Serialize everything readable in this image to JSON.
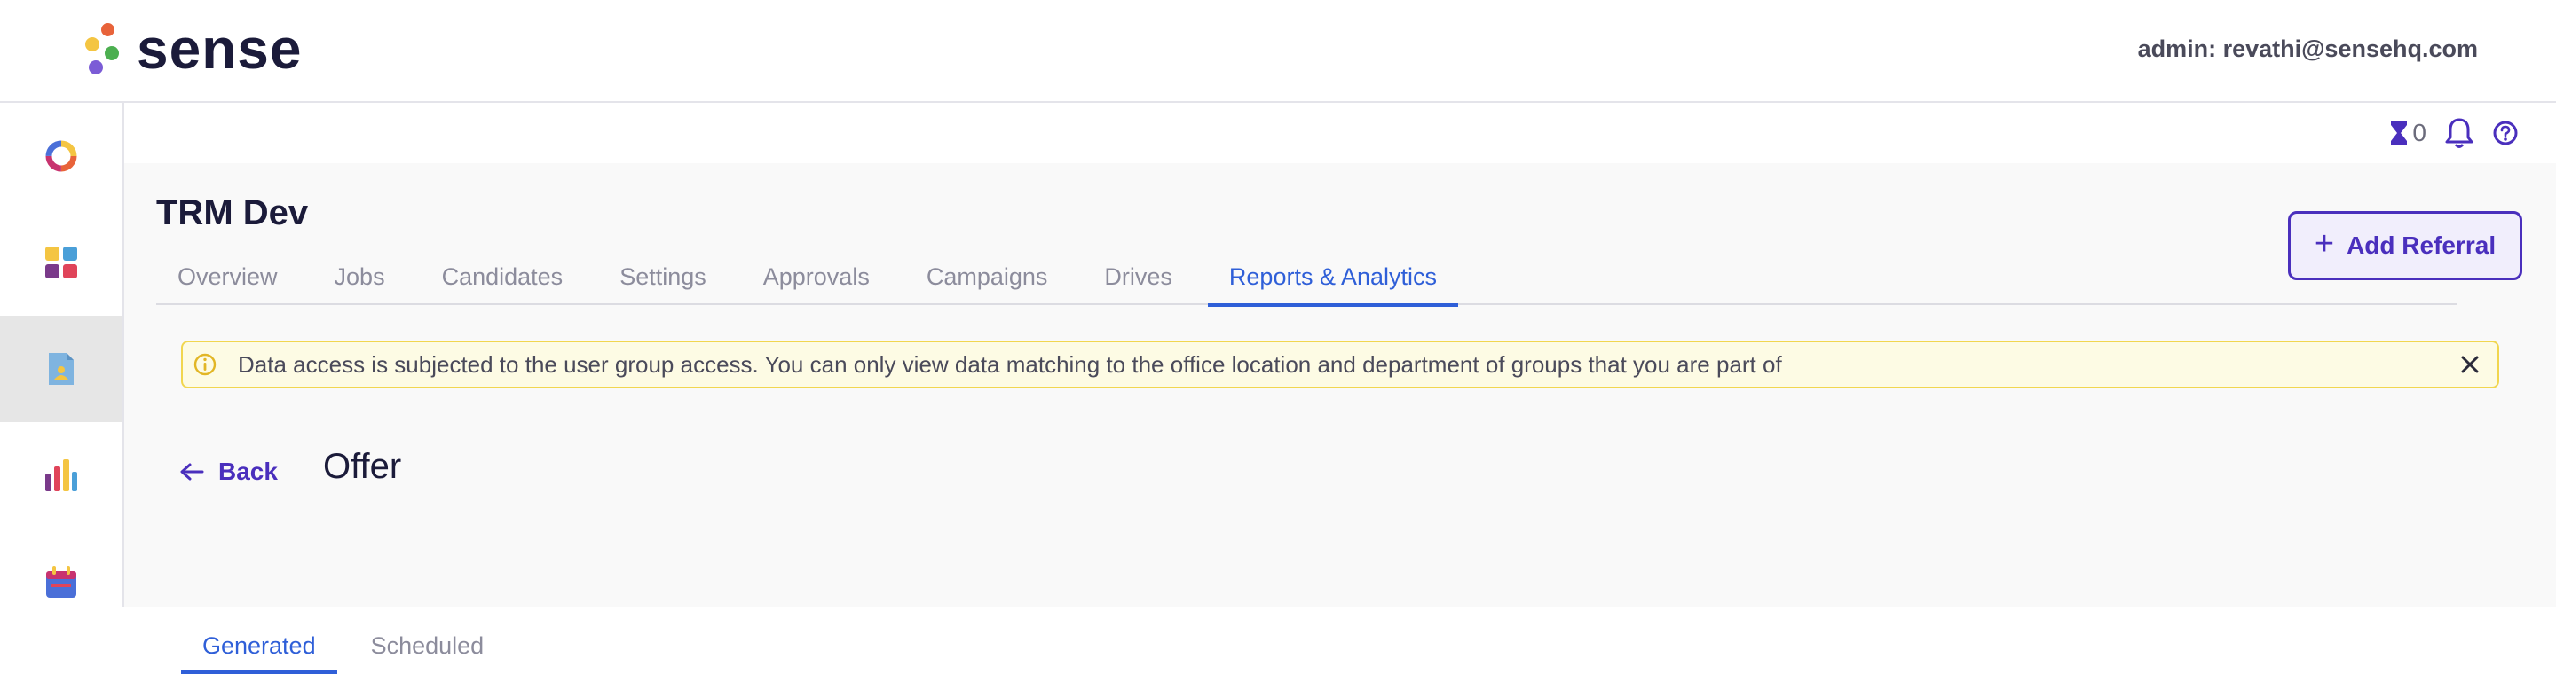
{
  "header": {
    "brand": "sense",
    "admin_label": "admin: revathi@sensehq.com"
  },
  "sidebar": {
    "items": [
      {
        "name": "dashboard-icon",
        "active": false
      },
      {
        "name": "apps-grid-icon",
        "active": false
      },
      {
        "name": "document-user-icon",
        "active": true
      },
      {
        "name": "bar-chart-icon",
        "active": false
      },
      {
        "name": "calendar-icon",
        "active": false
      }
    ]
  },
  "utility": {
    "hourglass_count": "0",
    "icons": [
      "hourglass-icon",
      "bell-icon",
      "help-icon"
    ]
  },
  "page": {
    "title": "TRM Dev",
    "add_button_label": "Add Referral"
  },
  "tabs": [
    {
      "label": "Overview",
      "active": false
    },
    {
      "label": "Jobs",
      "active": false
    },
    {
      "label": "Candidates",
      "active": false
    },
    {
      "label": "Settings",
      "active": false
    },
    {
      "label": "Approvals",
      "active": false
    },
    {
      "label": "Campaigns",
      "active": false
    },
    {
      "label": "Drives",
      "active": false
    },
    {
      "label": "Reports & Analytics",
      "active": true
    }
  ],
  "notice": {
    "text": "Data access is subjected to the user group access. You can only view data matching to the office location and department of groups that you are part of"
  },
  "report": {
    "back_label": "Back",
    "title": "Offer",
    "subtabs": [
      {
        "label": "Generated",
        "active": true
      },
      {
        "label": "Scheduled",
        "active": false
      }
    ]
  },
  "colors": {
    "accent": "#2f5fd8",
    "brand_purple": "#4a2fbd",
    "notice_border": "#f1d64f",
    "notice_bg": "#fdfbe4"
  }
}
